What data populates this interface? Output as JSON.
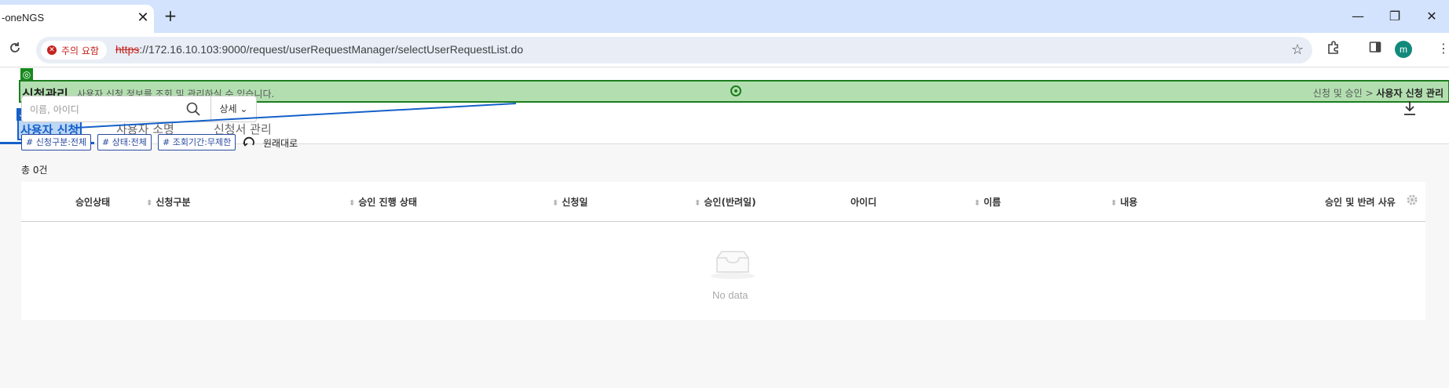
{
  "browser": {
    "tab_title": "-oneNGS",
    "tab_close": "✕",
    "new_tab": "+",
    "win_min": "—",
    "win_max": "❐",
    "win_close": "✕",
    "security_warning": "주의 요함",
    "url_scheme": "https",
    "url_rest": "://172.16.10.103:9000/request/userRequestManager/selectUserRequestList.do",
    "profile_initial": "m"
  },
  "header": {
    "title": "신청관리",
    "description": "사용자 신청 정보를 조회 및 관리하실 수 있습니다.",
    "breadcrumb_parent": "신청 및 승인",
    "breadcrumb_sep": ">",
    "breadcrumb_current": "사용자 신청 관리"
  },
  "tabs": [
    {
      "label": "사용자 신청",
      "active": true
    },
    {
      "label": "사용자 소명",
      "active": false
    },
    {
      "label": "신청서 관리",
      "active": false
    }
  ],
  "search": {
    "placeholder": "이름, 아이디",
    "value": "",
    "detail_label": "상세"
  },
  "filters": [
    {
      "label": "# 신청구분:전체"
    },
    {
      "label": "# 상태:전체"
    },
    {
      "label": "# 조회기간:무제한"
    }
  ],
  "reset_label": "원래대로",
  "total_label": "총 0건",
  "table": {
    "columns": [
      {
        "label": "승인상태",
        "sortable": false
      },
      {
        "label": "신청구분",
        "sortable": true
      },
      {
        "label": "승인 진행 상태",
        "sortable": true
      },
      {
        "label": "신청일",
        "sortable": true
      },
      {
        "label": "승인(반려일)",
        "sortable": true
      },
      {
        "label": "아이디",
        "sortable": false
      },
      {
        "label": "이름",
        "sortable": true
      },
      {
        "label": "내용",
        "sortable": true
      },
      {
        "label": "승인 및 반려 사유",
        "sortable": false
      }
    ],
    "rows": [],
    "empty_text": "No data"
  },
  "colors": {
    "accent": "#1560c9",
    "highlight_green": "#b3dfb0",
    "highlight_green_border": "#1d7d1f",
    "chip_blue": "#2a4aa0",
    "warning_red": "#c5221f"
  }
}
